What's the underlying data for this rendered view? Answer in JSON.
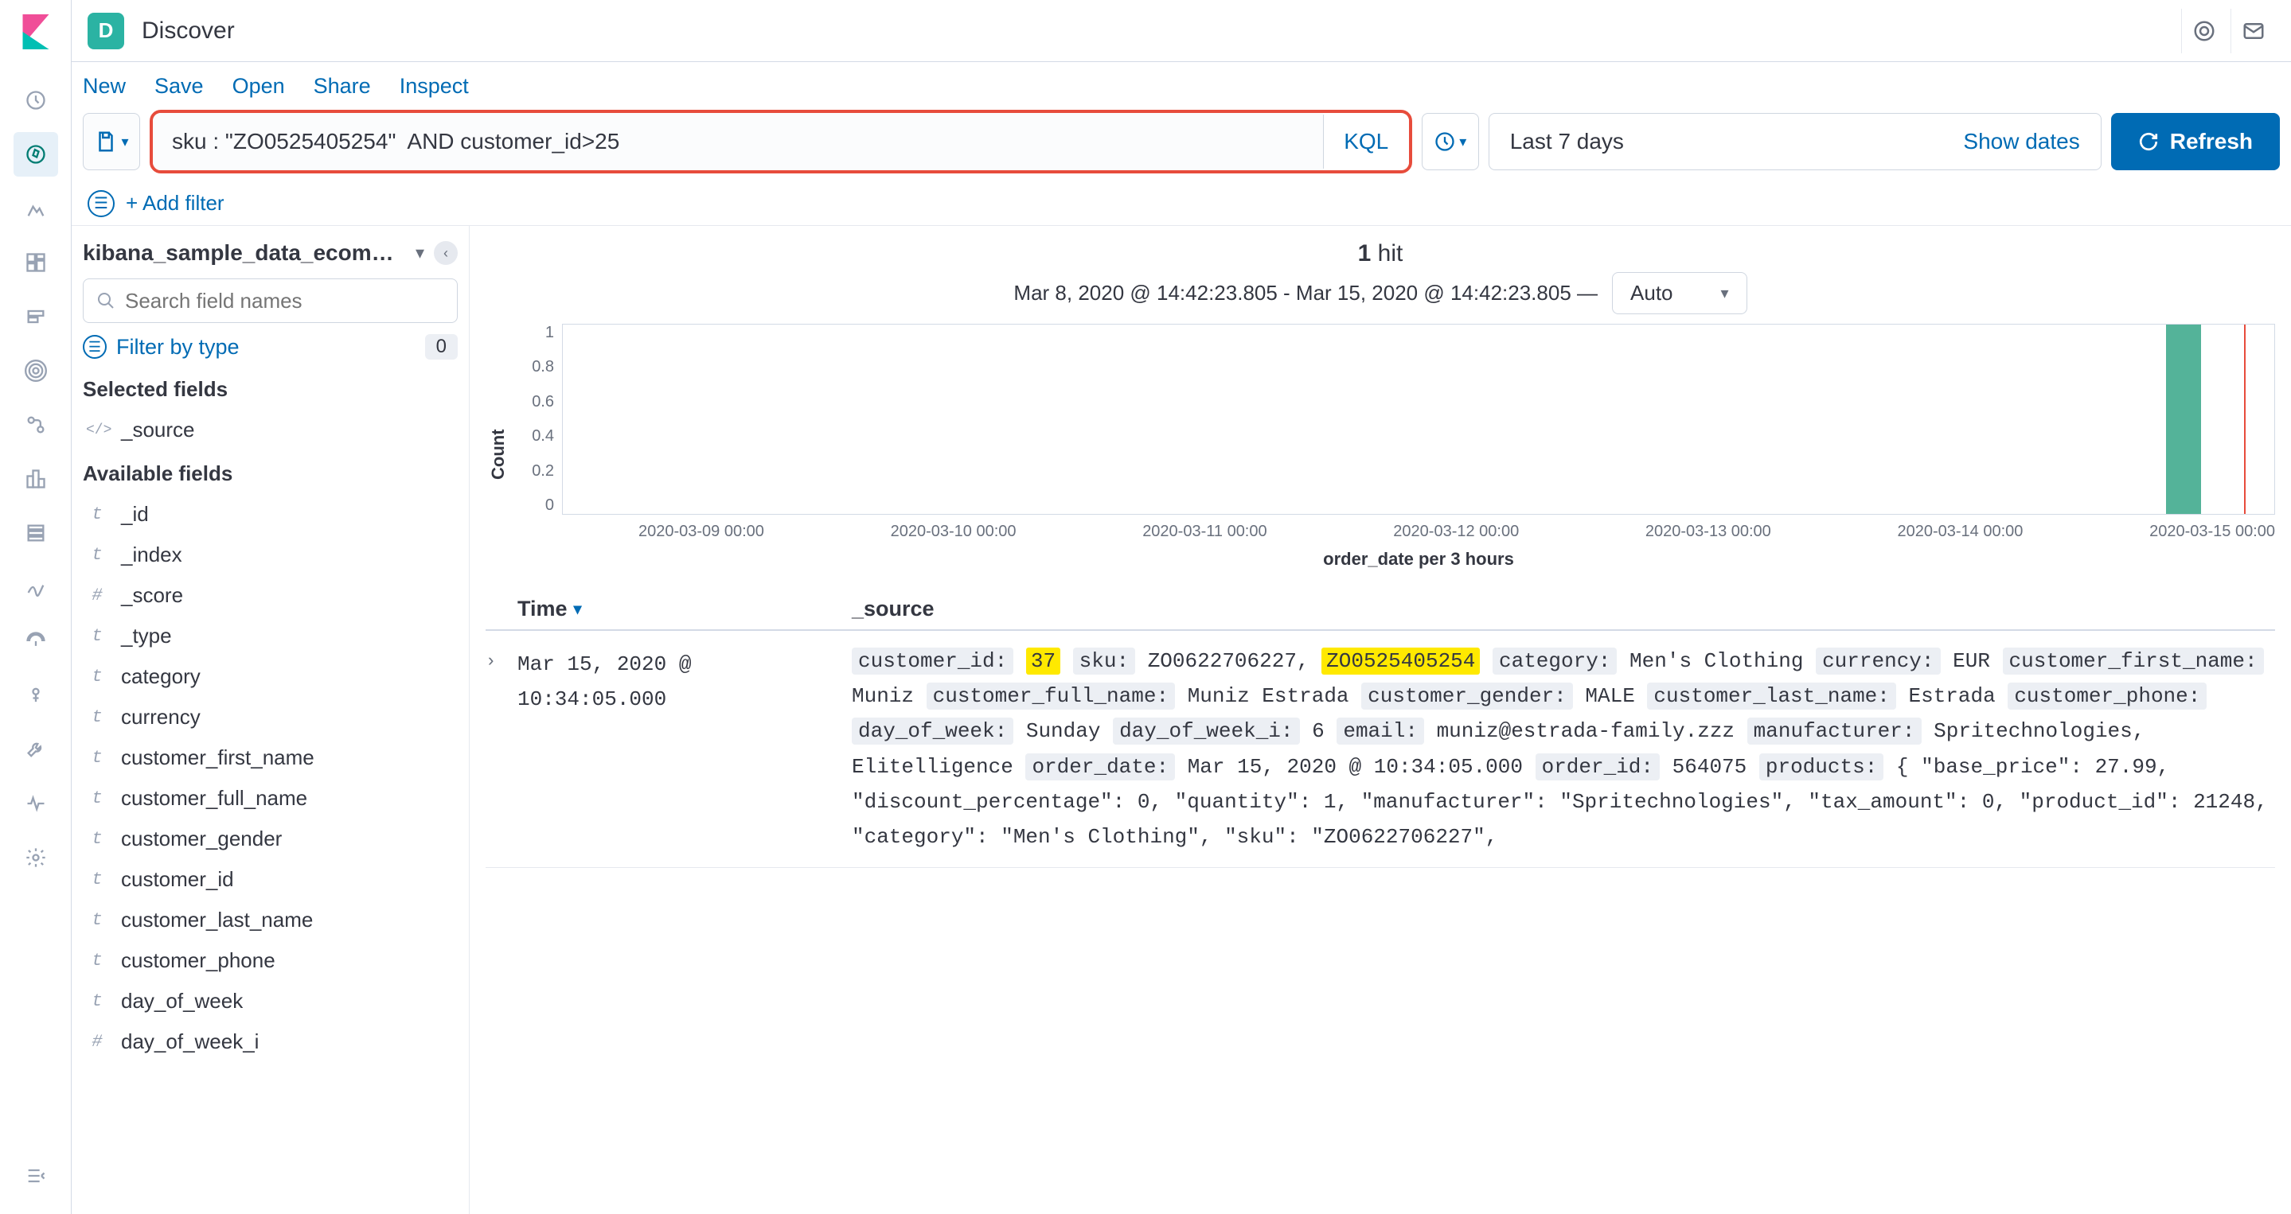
{
  "header": {
    "chip": "D",
    "title": "Discover"
  },
  "menu": {
    "new": "New",
    "save": "Save",
    "open": "Open",
    "share": "Share",
    "inspect": "Inspect"
  },
  "query": {
    "value": "sku : \"ZO0525405254\"  AND customer_id>25",
    "kql": "KQL",
    "date_label": "Last 7 days",
    "show_dates": "Show dates",
    "refresh": "Refresh",
    "add_filter": "+ Add filter"
  },
  "sidebar": {
    "index_pattern": "kibana_sample_data_ecom…",
    "search_placeholder": "Search field names",
    "filter_type": "Filter by type",
    "filter_count": "0",
    "selected_heading": "Selected fields",
    "available_heading": "Available fields",
    "selected": [
      {
        "icon": "</>",
        "name": "_source",
        "type": "code"
      }
    ],
    "available": [
      {
        "icon": "t",
        "name": "_id",
        "type": "t"
      },
      {
        "icon": "t",
        "name": "_index",
        "type": "t"
      },
      {
        "icon": "#",
        "name": "_score",
        "type": "n"
      },
      {
        "icon": "t",
        "name": "_type",
        "type": "t"
      },
      {
        "icon": "t",
        "name": "category",
        "type": "t"
      },
      {
        "icon": "t",
        "name": "currency",
        "type": "t"
      },
      {
        "icon": "t",
        "name": "customer_first_name",
        "type": "t"
      },
      {
        "icon": "t",
        "name": "customer_full_name",
        "type": "t"
      },
      {
        "icon": "t",
        "name": "customer_gender",
        "type": "t"
      },
      {
        "icon": "t",
        "name": "customer_id",
        "type": "t"
      },
      {
        "icon": "t",
        "name": "customer_last_name",
        "type": "t"
      },
      {
        "icon": "t",
        "name": "customer_phone",
        "type": "t"
      },
      {
        "icon": "t",
        "name": "day_of_week",
        "type": "t"
      },
      {
        "icon": "#",
        "name": "day_of_week_i",
        "type": "n"
      }
    ]
  },
  "results": {
    "hit_count": "1",
    "hit_label": "hit",
    "date_range": "Mar 8, 2020 @ 14:42:23.805 - Mar 15, 2020 @ 14:42:23.805 —",
    "interval": "Auto",
    "ylabel": "Count",
    "xlabel": "order_date per 3 hours",
    "col_time": "Time",
    "col_source": "_source",
    "row_time": "Mar 15, 2020 @ 10:34:05.000",
    "source_kv": [
      {
        "k": "customer_id:",
        "v": "37",
        "hl": true
      },
      {
        "k": "sku:",
        "v": "ZO0622706227, ",
        "post": "ZO0525405254",
        "posthl": true
      },
      {
        "k": "category:",
        "v": "Men's Clothing"
      },
      {
        "k": "currency:",
        "v": "EUR"
      },
      {
        "k": "customer_first_name:",
        "v": "Muniz"
      },
      {
        "k": "customer_full_name:",
        "v": "Muniz Estrada"
      },
      {
        "k": "customer_gender:",
        "v": "MALE"
      },
      {
        "k": "customer_last_name:",
        "v": "Estrada"
      },
      {
        "k": "customer_phone:",
        "v": " "
      },
      {
        "k": "day_of_week:",
        "v": "Sunday"
      },
      {
        "k": "day_of_week_i:",
        "v": "6"
      },
      {
        "k": "email:",
        "v": "muniz@estrada-family.zzz"
      },
      {
        "k": "manufacturer:",
        "v": "Spritechnologies, Elitelligence"
      },
      {
        "k": "order_date:",
        "v": "Mar 15, 2020 @ 10:34:05.000"
      },
      {
        "k": "order_id:",
        "v": "564075"
      },
      {
        "k": "products:",
        "v": "{ \"base_price\": 27.99, \"discount_percentage\": 0, \"quantity\": 1, \"manufacturer\": \"Spritechnologies\", \"tax_amount\": 0, \"product_id\": 21248, \"category\": \"Men's Clothing\", \"sku\": \"ZO0622706227\","
      }
    ]
  },
  "chart_data": {
    "type": "bar",
    "title": "",
    "ylabel": "Count",
    "xlabel": "order_date per 3 hours",
    "ylim": [
      0,
      1
    ],
    "y_ticks": [
      "1",
      "0.8",
      "0.6",
      "0.4",
      "0.2",
      "0"
    ],
    "x_ticks": [
      "2020-03-09 00:00",
      "2020-03-10 00:00",
      "2020-03-11 00:00",
      "2020-03-12 00:00",
      "2020-03-13 00:00",
      "2020-03-14 00:00",
      "2020-03-15 00:00"
    ],
    "series": [
      {
        "name": "count",
        "x": "2020-03-15 09:00",
        "value": 1
      }
    ],
    "marker": "2020-03-15 14:42:23.805"
  }
}
